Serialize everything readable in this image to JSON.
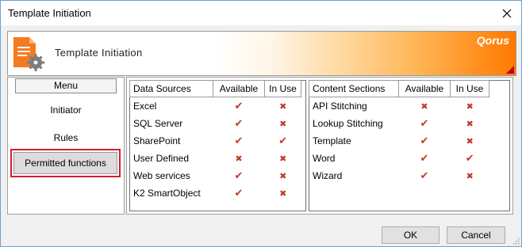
{
  "window": {
    "title": "Template Initiation"
  },
  "banner": {
    "title": "Template Initiation",
    "brand": "Qorus"
  },
  "menu": {
    "header": "Menu",
    "items": [
      {
        "label": "Initiator"
      },
      {
        "label": "Rules"
      },
      {
        "label": "Permitted functions",
        "selected": true
      }
    ]
  },
  "data_sources": {
    "headers": [
      "Data Sources",
      "Available",
      "In Use"
    ],
    "rows": [
      {
        "name": "Excel",
        "available": "✔",
        "in_use": "✖"
      },
      {
        "name": "SQL Server",
        "available": "✔",
        "in_use": "✖"
      },
      {
        "name": "SharePoint",
        "available": "✔",
        "in_use": "✔"
      },
      {
        "name": "User Defined",
        "available": "✖",
        "in_use": "✖"
      },
      {
        "name": "Web services",
        "available": "✔",
        "in_use": "✖"
      },
      {
        "name": "K2 SmartObject",
        "available": "✔",
        "in_use": "✖"
      }
    ]
  },
  "content_sections": {
    "headers": [
      "Content Sections",
      "Available",
      "In Use"
    ],
    "rows": [
      {
        "name": "API Stitching",
        "available": "✖",
        "in_use": "✖"
      },
      {
        "name": "Lookup Stitching",
        "available": "✔",
        "in_use": "✖"
      },
      {
        "name": "Template",
        "available": "✔",
        "in_use": "✖"
      },
      {
        "name": "Word",
        "available": "✔",
        "in_use": "✔"
      },
      {
        "name": "Wizard",
        "available": "✔",
        "in_use": "✖"
      }
    ]
  },
  "buttons": {
    "ok": "OK",
    "cancel": "Cancel"
  },
  "colors": {
    "check": "#c0392b",
    "accent": "#ff7a00",
    "selection_border": "#d81c2a"
  }
}
